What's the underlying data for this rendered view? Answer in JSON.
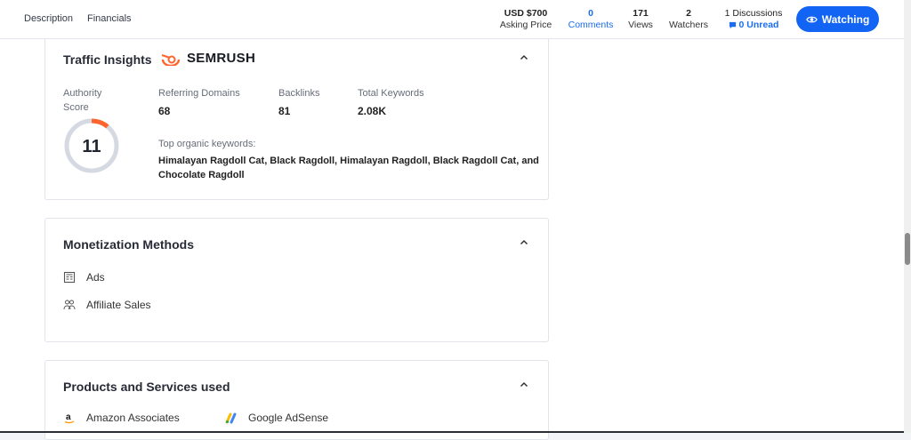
{
  "nav": {
    "description": "Description",
    "financials": "Financials"
  },
  "stats": {
    "price": {
      "value": "USD $700",
      "label": "Asking Price"
    },
    "comments": {
      "value": "0",
      "label": "Comments"
    },
    "views": {
      "value": "171",
      "label": "Views"
    },
    "watchers": {
      "value": "2",
      "label": "Watchers"
    },
    "discussions": {
      "value": "1 Discussions",
      "label": "0 Unread"
    }
  },
  "watch_button": "Watching",
  "traffic": {
    "title": "Traffic Insights",
    "brand": "SEMRUSH",
    "authority_label_1": "Authority",
    "authority_label_2": "Score",
    "authority_value": "11",
    "authority_fraction": 0.11,
    "referring_label": "Referring Domains",
    "referring_value": "68",
    "backlinks_label": "Backlinks",
    "backlinks_value": "81",
    "keywords_label": "Total Keywords",
    "keywords_value": "2.08K",
    "top_label": "Top organic keywords:",
    "top_line1": "Himalayan Ragdoll Cat, Black Ragdoll, Himalayan Ragdoll, Black Ragdoll Cat, and",
    "top_line2": "Chocolate Ragdoll"
  },
  "monetization": {
    "title": "Monetization Methods",
    "items": [
      "Ads",
      "Affiliate Sales"
    ]
  },
  "products": {
    "title": "Products and Services used",
    "items": [
      "Amazon Associates",
      "Google AdSense"
    ]
  },
  "colors": {
    "accent": "#1264f5",
    "semrush": "#ff642d"
  }
}
